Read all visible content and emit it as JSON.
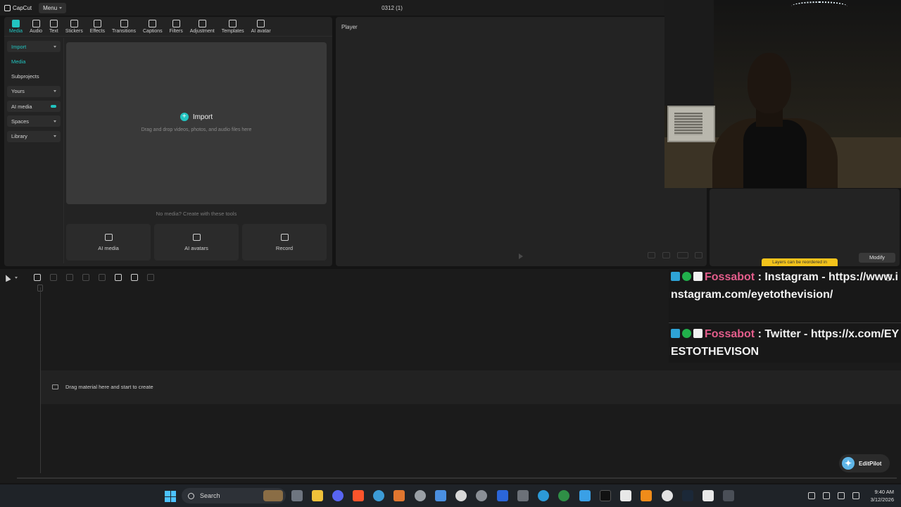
{
  "titlebar": {
    "app_name": "CapCut",
    "menu_label": "Menu",
    "document_title": "0312 (1)"
  },
  "tool_tabs": [
    {
      "label": "Media",
      "icon": "media-icon",
      "active": true
    },
    {
      "label": "Audio",
      "icon": "audio-icon"
    },
    {
      "label": "Text",
      "icon": "text-icon"
    },
    {
      "label": "Stickers",
      "icon": "stickers-icon"
    },
    {
      "label": "Effects",
      "icon": "effects-icon"
    },
    {
      "label": "Transitions",
      "icon": "transitions-icon"
    },
    {
      "label": "Captions",
      "icon": "captions-icon"
    },
    {
      "label": "Filters",
      "icon": "filters-icon"
    },
    {
      "label": "Adjustment",
      "icon": "adjustment-icon"
    },
    {
      "label": "Templates",
      "icon": "templates-icon"
    },
    {
      "label": "AI avatar",
      "icon": "ai-avatar-icon"
    }
  ],
  "side_nav": [
    {
      "label": "Import"
    },
    {
      "label": "Media"
    },
    {
      "label": "Subprojects"
    },
    {
      "label": "Yours"
    },
    {
      "label": "AI media"
    },
    {
      "label": "Spaces"
    },
    {
      "label": "Library"
    }
  ],
  "import_area": {
    "button_label": "Import",
    "hint": "Drag and drop videos, photos, and audio files here",
    "no_media": "No media? Create with these tools"
  },
  "tool_cards": [
    {
      "label": "AI media",
      "icon": "ai-media-icon"
    },
    {
      "label": "AI avatars",
      "icon": "ai-avatars-icon"
    },
    {
      "label": "Record",
      "icon": "record-icon"
    }
  ],
  "player": {
    "title": "Player"
  },
  "details": {
    "tooltip": "Layers can be reordered in",
    "modify_label": "Modify"
  },
  "timeline": {
    "drop_hint": "Drag material here and start to create"
  },
  "chat": {
    "messages": [
      {
        "user": "Fossabot",
        "text": " : Instagram - https://www.instagram.com/eyetothevision/"
      },
      {
        "user": "Fossabot",
        "text": " : Twitter - https://x.com/EYESTOTHEVISON"
      }
    ]
  },
  "editpilot": {
    "label": "EditPilot"
  },
  "taskbar": {
    "search_placeholder": "Search",
    "time": "9:40 AM",
    "date": "3/12/2026"
  },
  "colors": {
    "accent": "#22c4c0",
    "chat_user": "#e35d8b",
    "tooltip": "#f3c31b"
  }
}
